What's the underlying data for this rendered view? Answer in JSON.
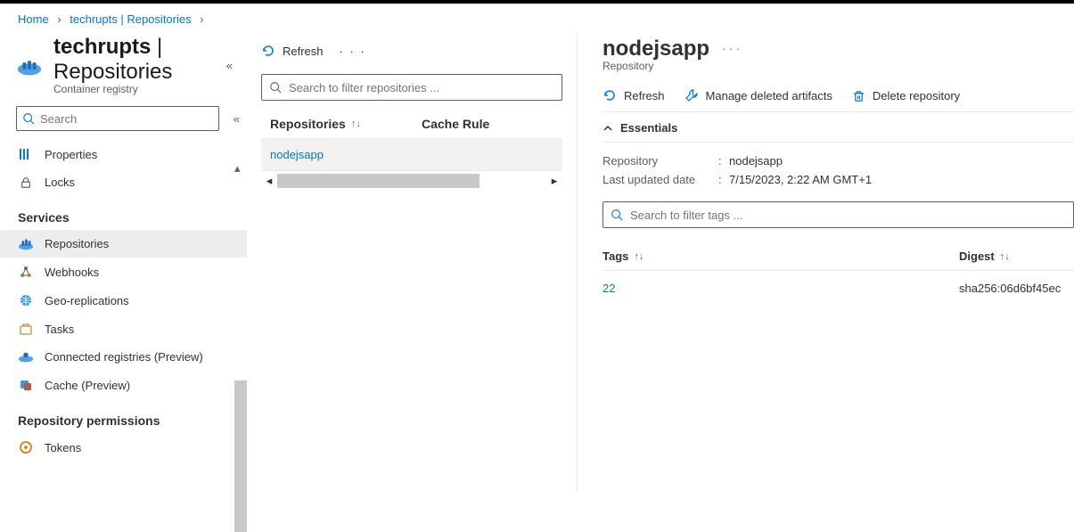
{
  "breadcrumb": {
    "home": "Home",
    "item": "techrupts | Repositories"
  },
  "header": {
    "title_primary": "techrupts",
    "title_separator": " | ",
    "title_secondary": "Repositories",
    "subtitle": "Container registry"
  },
  "sidebar": {
    "search_placeholder": "Search",
    "items_top": [
      {
        "label": "Properties",
        "icon": "properties-icon"
      },
      {
        "label": "Locks",
        "icon": "lock-icon"
      }
    ],
    "heading_services": "Services",
    "items_services": [
      {
        "label": "Repositories",
        "icon": "repo-icon",
        "selected": true
      },
      {
        "label": "Webhooks",
        "icon": "webhook-icon"
      },
      {
        "label": "Geo-replications",
        "icon": "globe-icon"
      },
      {
        "label": "Tasks",
        "icon": "tasks-icon"
      },
      {
        "label": "Connected registries (Preview)",
        "icon": "connected-icon"
      },
      {
        "label": "Cache (Preview)",
        "icon": "cache-icon"
      }
    ],
    "heading_permissions": "Repository permissions",
    "items_permissions": [
      {
        "label": "Tokens",
        "icon": "token-icon"
      }
    ]
  },
  "mid": {
    "refresh": "Refresh",
    "filter_placeholder": "Search to filter repositories ...",
    "col_repositories": "Repositories",
    "col_cache": "Cache Rule",
    "rows": [
      {
        "name": "nodejsapp"
      }
    ]
  },
  "detail": {
    "title": "nodejsapp",
    "subtitle": "Repository",
    "toolbar": {
      "refresh": "Refresh",
      "manage_deleted": "Manage deleted artifacts",
      "delete_repo": "Delete repository"
    },
    "essentials_label": "Essentials",
    "essentials": {
      "repository_key": "Repository",
      "repository_val": "nodejsapp",
      "updated_key": "Last updated date",
      "updated_val": "7/15/2023, 2:22 AM GMT+1"
    },
    "tag_filter_placeholder": "Search to filter tags ...",
    "tag_col_tags": "Tags",
    "tag_col_digest": "Digest",
    "tag_rows": [
      {
        "tag": "22",
        "digest": "sha256:06d6bf45ec"
      }
    ]
  }
}
